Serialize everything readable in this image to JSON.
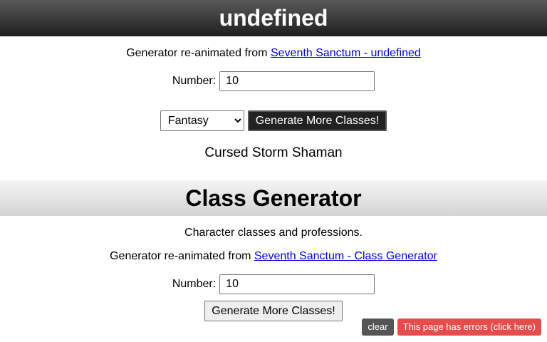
{
  "section1": {
    "title": "undefined",
    "credit_prefix": "Generator re-animated from",
    "credit_link": "Seventh Sanctum - undefined",
    "number_label": "Number:",
    "number_value": "10",
    "genre_options": [
      "Fantasy"
    ],
    "genre_selected": "Fantasy",
    "generate_label": "Generate More Classes!",
    "result": "Cursed Storm Shaman"
  },
  "section2": {
    "title": "Class Generator",
    "description": "Character classes and professions.",
    "credit_prefix": "Generator re-animated from",
    "credit_link": "Seventh Sanctum - Class Generator",
    "number_label": "Number:",
    "number_value": "10",
    "generate_label": "Generate More Classes!"
  },
  "error_bar": {
    "clear_icon": "",
    "clear_label": "clear",
    "errors_label": "This page has errors (click here)"
  },
  "colors": {
    "link": "#0000ee",
    "error_bg": "#e74c4c",
    "clear_bg": "#555555"
  }
}
